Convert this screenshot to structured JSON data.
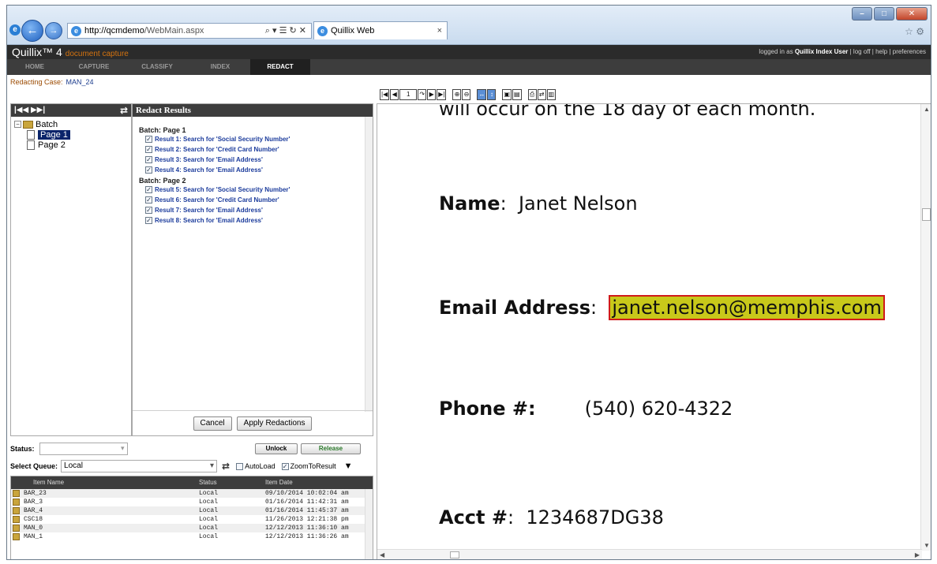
{
  "browser": {
    "url_host": "http://qcmdemo",
    "url_path": "/WebMain.aspx",
    "addr_tools": "⌕ ▾ ☰ ↻ ✕",
    "tab_title": "Quillix Web",
    "tab_close": "×",
    "right_icons": "☆ ⚙",
    "win_min": "–",
    "win_max": "□",
    "win_close": "✕"
  },
  "app": {
    "brand": "Quillix™ 4",
    "brand_sub": "document capture",
    "user_prefix": "logged in as",
    "user_name": "Quillix Index User",
    "user_links": "| log off | help | preferences",
    "nav": [
      "HOME",
      "CAPTURE",
      "CLASSIFY",
      "INDEX",
      "REDACT"
    ]
  },
  "case": {
    "label": "Redacting Case:",
    "value": "MAN_24"
  },
  "tree": {
    "nav_glyphs": "|◀◀ ▶▶|",
    "refresh": "⇄",
    "root": "Batch",
    "pages": [
      "Page 1",
      "Page 2"
    ]
  },
  "results": {
    "title": "Redact Results",
    "groups": [
      {
        "title": "Batch: Page 1",
        "items": [
          "Result 1: Search for 'Social Security Number'",
          "Result 2: Search for 'Credit Card Number'",
          "Result 3: Search for 'Email Address'",
          "Result 4: Search for 'Email Address'"
        ]
      },
      {
        "title": "Batch: Page 2",
        "items": [
          "Result 5: Search for 'Social Security Number'",
          "Result 6: Search for 'Credit Card Number'",
          "Result 7: Search for 'Email Address'",
          "Result 8: Search for 'Email Address'"
        ]
      }
    ],
    "cancel": "Cancel",
    "apply": "Apply Redactions"
  },
  "status": {
    "label": "Status:",
    "unlock": "Unlock",
    "release": "Release"
  },
  "queue": {
    "label": "Select Queue:",
    "value": "Local",
    "refresh": "⇄",
    "autoload": "AutoLoad",
    "zoom": "ZoomToResult",
    "caret": "▼"
  },
  "grid": {
    "headers": [
      "Item Name",
      "Status",
      "Item Date"
    ],
    "rows": [
      [
        "BAR_23",
        "Local",
        "09/10/2014 10:02:04 am"
      ],
      [
        "BAR_3",
        "Local",
        "01/16/2014 11:42:31 am"
      ],
      [
        "BAR_4",
        "Local",
        "01/16/2014 11:45:37 am"
      ],
      [
        "CSC18",
        "Local",
        "11/26/2013 12:21:38 pm"
      ],
      [
        "MAN_0",
        "Local",
        "12/12/2013 11:36:10 am"
      ],
      [
        "MAN_1",
        "Local",
        "12/12/2013 11:36:26 am"
      ]
    ]
  },
  "toolbar": {
    "buttons": [
      "|◀",
      "◀",
      "1",
      "↷",
      "▶",
      "▶|",
      "⊕",
      "⊖",
      "↔",
      "↕",
      "▣",
      "▤",
      "⎙",
      "⇄",
      "▥"
    ]
  },
  "document": {
    "top_fragment": "will occur on the 18   day of each month.",
    "fields": [
      {
        "label": "Name",
        "sep": ":",
        "value": "Janet Nelson",
        "redacted": false
      },
      {
        "label": "Email Address",
        "sep": ":",
        "value": "janet.nelson@memphis.com",
        "redacted": true
      },
      {
        "label": "Phone #:",
        "sep": "",
        "value": "(540) 620-4322",
        "redacted": false
      },
      {
        "label": "Acct #",
        "sep": ":",
        "value": "1234687DG38",
        "redacted": false
      }
    ]
  },
  "colors": {
    "redact_fill": "#c8c81a",
    "redact_border": "#d01a1a",
    "accent_orange": "#d4730f",
    "header_dark": "#2b2b2b",
    "link_blue": "#1c3c9c"
  }
}
